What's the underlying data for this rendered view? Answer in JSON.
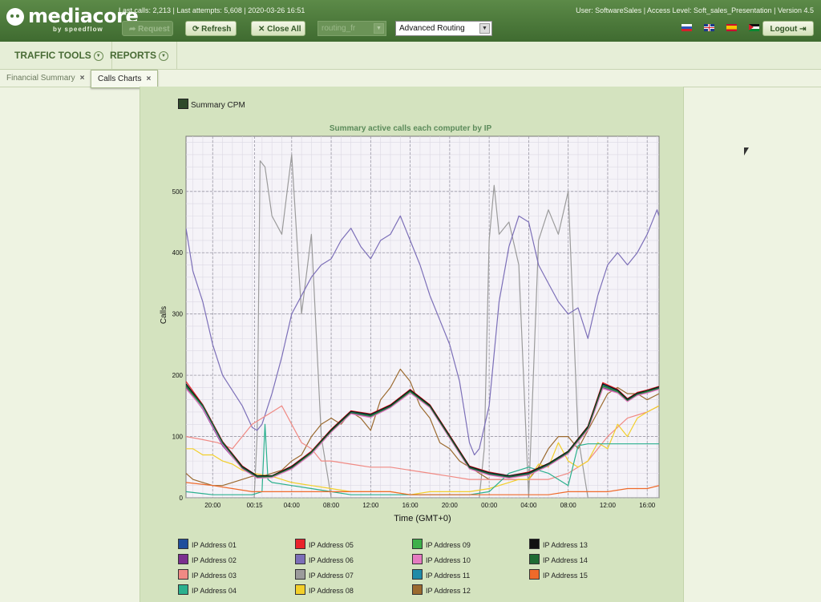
{
  "app": {
    "logo_name": "mediacore",
    "logo_tag": "by speedflow",
    "status_line": "Last calls: 2,213 | Last attempts: 5,608 | 2020-03-26 16:51",
    "user_line": "User: SoftwareSales | Access Level:    Soft_sales_Presentation | Version 4.5"
  },
  "toolbar": {
    "request_label": "Request",
    "refresh_label": "Refresh",
    "close_all_label": "Close All",
    "routing_select": "routing_fr",
    "routing_mode_select": "Advanced Routing",
    "logout_label": "Logout"
  },
  "menu": [
    {
      "label": "TRAFFIC TOOLS"
    },
    {
      "label": "REPORTS"
    }
  ],
  "tabs": [
    {
      "label": "Financial Summary",
      "active": false
    },
    {
      "label": "Calls Charts",
      "active": true
    }
  ],
  "colors": {
    "header": "#4a7a3a",
    "panel": "#d4e3bf",
    "plot_bg": "#f5f3f8"
  },
  "chart_data": {
    "type": "line",
    "top_legend": "Summary CPM",
    "title": "Summary active calls each computer by IP",
    "xlabel": "Time (GMT+0)",
    "ylabel": "Calls",
    "ylim": [
      0,
      590
    ],
    "yticks": [
      0,
      100,
      200,
      300,
      400,
      500
    ],
    "xlim": [
      17.3,
      65.2
    ],
    "xticks": [
      {
        "v": 20,
        "label": "20:00"
      },
      {
        "v": 24.25,
        "label": "00:15"
      },
      {
        "v": 28,
        "label": "04:00"
      },
      {
        "v": 32,
        "label": "08:00"
      },
      {
        "v": 36,
        "label": "12:00"
      },
      {
        "v": 40,
        "label": "16:00"
      },
      {
        "v": 44,
        "label": "20:00"
      },
      {
        "v": 48,
        "label": "00:00"
      },
      {
        "v": 52,
        "label": "04:00"
      },
      {
        "v": 56,
        "label": "08:00"
      },
      {
        "v": 60,
        "label": "12:00"
      },
      {
        "v": 64,
        "label": "16:00"
      }
    ],
    "series": [
      {
        "name": "IP Address 01",
        "color": "#1f4e9c",
        "x": [
          17.3,
          19,
          21,
          23,
          24.5,
          26,
          28,
          30,
          32,
          34,
          36,
          38,
          40,
          42,
          44,
          46,
          48,
          50,
          52,
          54,
          56,
          58,
          59.5,
          61,
          62,
          63,
          64,
          65.2
        ],
        "values": [
          185,
          150,
          90,
          50,
          35,
          35,
          50,
          75,
          110,
          140,
          135,
          150,
          175,
          150,
          100,
          50,
          40,
          35,
          40,
          55,
          75,
          115,
          185,
          175,
          160,
          170,
          175,
          180
        ]
      },
      {
        "name": "IP Address 02",
        "color": "#7b2f8f",
        "x": [
          17.3,
          19,
          21,
          23,
          24.5,
          26,
          28,
          30,
          32,
          34,
          36,
          38,
          40,
          42,
          44,
          46,
          48,
          50,
          52,
          54,
          56,
          58,
          59.5,
          61,
          62,
          63,
          64,
          65.2
        ],
        "values": [
          180,
          145,
          85,
          48,
          33,
          34,
          48,
          72,
          108,
          138,
          132,
          148,
          172,
          148,
          98,
          48,
          38,
          33,
          38,
          53,
          73,
          112,
          180,
          172,
          158,
          168,
          172,
          178
        ]
      },
      {
        "name": "IP Address 03",
        "color": "#f08a84",
        "x": [
          17.3,
          19,
          20.5,
          22,
          24,
          26,
          27,
          28,
          29,
          30,
          31,
          32,
          34,
          36,
          38,
          40,
          42,
          44,
          46,
          48,
          50,
          52,
          54,
          56,
          58,
          60,
          62,
          64,
          65.2
        ],
        "values": [
          100,
          95,
          90,
          80,
          120,
          140,
          150,
          120,
          90,
          80,
          60,
          60,
          55,
          50,
          50,
          45,
          40,
          35,
          30,
          30,
          30,
          30,
          30,
          40,
          60,
          100,
          130,
          140,
          150
        ]
      },
      {
        "name": "IP Address 04",
        "color": "#2bb08e",
        "x": [
          17.3,
          20,
          22,
          24,
          25,
          25.3,
          25.6,
          26,
          28,
          30,
          32,
          34,
          36,
          38,
          40,
          42,
          44,
          46,
          48,
          50,
          52,
          54,
          56,
          57,
          58,
          60,
          62,
          64,
          65.2
        ],
        "values": [
          10,
          5,
          5,
          5,
          10,
          120,
          30,
          25,
          20,
          15,
          10,
          5,
          5,
          5,
          5,
          5,
          5,
          5,
          10,
          40,
          50,
          40,
          20,
          85,
          88,
          88,
          88,
          88,
          88
        ]
      },
      {
        "name": "IP Address 05",
        "color": "#e8232b",
        "x": [
          17.3,
          19,
          21,
          23,
          24.5,
          26,
          28,
          30,
          32,
          34,
          36,
          38,
          40,
          42,
          44,
          46,
          48,
          50,
          52,
          54,
          56,
          58,
          59.5,
          61,
          62,
          63,
          64,
          65.2
        ],
        "values": [
          190,
          152,
          92,
          52,
          36,
          36,
          52,
          76,
          112,
          142,
          137,
          152,
          177,
          152,
          102,
          52,
          42,
          36,
          42,
          56,
          76,
          117,
          188,
          177,
          162,
          172,
          176,
          182
        ]
      },
      {
        "name": "IP Address 06",
        "color": "#7c6fb8",
        "x": [
          17.3,
          18,
          19,
          20,
          21,
          22,
          23,
          24,
          24.5,
          25,
          26,
          27,
          28,
          29,
          30,
          31,
          32,
          33,
          34,
          35,
          36,
          37,
          38,
          39,
          40,
          41,
          42,
          43,
          44,
          45,
          46,
          46.5,
          47,
          48,
          49,
          50,
          51,
          52,
          53,
          54,
          55,
          56,
          57,
          58,
          59,
          60,
          61,
          62,
          63,
          64,
          65,
          65.2
        ],
        "values": [
          440,
          370,
          320,
          250,
          200,
          175,
          150,
          115,
          110,
          120,
          170,
          230,
          300,
          330,
          360,
          380,
          390,
          420,
          440,
          410,
          390,
          420,
          430,
          460,
          420,
          380,
          330,
          290,
          250,
          190,
          90,
          70,
          80,
          150,
          320,
          410,
          460,
          450,
          380,
          350,
          320,
          300,
          310,
          260,
          330,
          380,
          400,
          380,
          400,
          430,
          470,
          460
        ]
      },
      {
        "name": "IP Address 07",
        "color": "#9b9b9b",
        "x": [
          17.3,
          24.2,
          24.5,
          24.8,
          25.3,
          26,
          27,
          28,
          29,
          30,
          31,
          32,
          33,
          34,
          46,
          47,
          47.5,
          48,
          48.5,
          49,
          50,
          51,
          52,
          53,
          54,
          55,
          56,
          57,
          58,
          59,
          65.2
        ],
        "values": [
          0,
          0,
          100,
          550,
          540,
          460,
          430,
          560,
          300,
          430,
          100,
          0,
          0,
          0,
          0,
          0,
          80,
          420,
          510,
          430,
          450,
          380,
          0,
          420,
          470,
          430,
          500,
          100,
          0,
          0,
          0
        ]
      },
      {
        "name": "IP Address 08",
        "color": "#f2cf2a",
        "x": [
          17.3,
          18,
          19,
          20,
          21,
          22,
          23,
          24,
          26,
          28,
          30,
          32,
          34,
          36,
          38,
          40,
          42,
          44,
          46,
          48,
          50,
          51,
          52,
          53,
          54,
          55,
          56,
          57,
          58,
          59,
          60,
          61,
          62,
          63,
          64,
          65.2
        ],
        "values": [
          80,
          80,
          70,
          70,
          60,
          55,
          45,
          40,
          35,
          25,
          20,
          15,
          10,
          10,
          10,
          5,
          10,
          10,
          10,
          15,
          25,
          30,
          30,
          55,
          50,
          90,
          60,
          50,
          60,
          90,
          80,
          120,
          100,
          130,
          140,
          150
        ]
      },
      {
        "name": "IP Address 09",
        "color": "#3db04a",
        "x": [
          17.3,
          19,
          21,
          23,
          24.5,
          26,
          28,
          30,
          32,
          34,
          36,
          38,
          40,
          42,
          44,
          46,
          48,
          50,
          52,
          54,
          56,
          58,
          59.5,
          61,
          62,
          63,
          64,
          65.2
        ],
        "values": [
          182,
          148,
          88,
          49,
          34,
          34,
          49,
          73,
          109,
          139,
          133,
          149,
          173,
          149,
          99,
          49,
          39,
          34,
          39,
          54,
          74,
          113,
          182,
          173,
          159,
          169,
          173,
          179
        ]
      },
      {
        "name": "IP Address 10",
        "color": "#e57bc1",
        "x": [
          17.3,
          19,
          21,
          23,
          24.5,
          26,
          28,
          30,
          32,
          34,
          36,
          38,
          40,
          42,
          44,
          46,
          48,
          50,
          52,
          54,
          56,
          58,
          59.5,
          61,
          62,
          63,
          64,
          65.2
        ],
        "values": [
          178,
          146,
          87,
          47,
          32,
          33,
          47,
          71,
          107,
          137,
          131,
          147,
          171,
          147,
          97,
          47,
          37,
          32,
          37,
          52,
          72,
          111,
          178,
          171,
          157,
          167,
          171,
          177
        ]
      },
      {
        "name": "IP Address 11",
        "color": "#1f8ba8",
        "x": [
          17.3,
          19,
          21,
          23,
          24.5,
          26,
          28,
          30,
          32,
          34,
          36,
          38,
          40,
          42,
          44,
          46,
          48,
          50,
          52,
          54,
          56,
          58,
          59.5,
          61,
          62,
          63,
          64,
          65.2
        ],
        "values": [
          184,
          149,
          89,
          50,
          35,
          35,
          50,
          74,
          110,
          140,
          134,
          150,
          174,
          150,
          100,
          50,
          40,
          35,
          40,
          55,
          75,
          114,
          184,
          174,
          160,
          170,
          174,
          180
        ]
      },
      {
        "name": "IP Address 12",
        "color": "#9b6a2f",
        "x": [
          17.3,
          18,
          19,
          20,
          21,
          22,
          23,
          24,
          25,
          26,
          27,
          28,
          29,
          30,
          31,
          32,
          33,
          34,
          35,
          36,
          37,
          38,
          39,
          40,
          41,
          42,
          43,
          44,
          45,
          46,
          47,
          48,
          49,
          50,
          51,
          52,
          53,
          54,
          55,
          56,
          57,
          58,
          59,
          60,
          61,
          62,
          63,
          64,
          65.2
        ],
        "values": [
          40,
          30,
          25,
          20,
          20,
          25,
          30,
          35,
          35,
          40,
          45,
          60,
          70,
          100,
          120,
          130,
          120,
          140,
          130,
          110,
          160,
          180,
          210,
          190,
          150,
          130,
          90,
          80,
          60,
          50,
          40,
          30,
          30,
          30,
          30,
          30,
          50,
          80,
          100,
          100,
          80,
          110,
          140,
          170,
          180,
          170,
          170,
          160,
          170
        ]
      },
      {
        "name": "IP Address 13",
        "color": "#111111",
        "x": [
          17.3,
          19,
          21,
          23,
          24.5,
          26,
          28,
          30,
          32,
          34,
          36,
          38,
          40,
          42,
          44,
          46,
          48,
          50,
          52,
          54,
          56,
          58,
          59.5,
          61,
          62,
          63,
          64,
          65.2
        ],
        "values": [
          186,
          151,
          91,
          51,
          36,
          36,
          51,
          75,
          111,
          141,
          136,
          151,
          176,
          151,
          101,
          51,
          41,
          36,
          41,
          56,
          76,
          116,
          186,
          176,
          161,
          171,
          175,
          181
        ]
      },
      {
        "name": "IP Address 14",
        "color": "#1f6b34",
        "x": [
          17.3,
          19,
          21,
          23,
          24.5,
          26,
          28,
          30,
          32,
          34,
          36,
          38,
          40,
          42,
          44,
          46,
          48,
          50,
          52,
          54,
          56,
          58,
          59.5,
          61,
          62,
          63,
          64,
          65.2
        ],
        "values": [
          183,
          150,
          90,
          49,
          34,
          35,
          49,
          74,
          109,
          139,
          134,
          149,
          174,
          149,
          99,
          49,
          39,
          34,
          39,
          54,
          74,
          114,
          183,
          174,
          159,
          169,
          174,
          179
        ]
      },
      {
        "name": "IP Address 15",
        "color": "#ef6a2a",
        "x": [
          17.3,
          20,
          22,
          24,
          26,
          28,
          30,
          32,
          34,
          36,
          38,
          40,
          42,
          44,
          46,
          48,
          50,
          52,
          54,
          56,
          58,
          60,
          62,
          64,
          65.2
        ],
        "values": [
          25,
          20,
          15,
          10,
          10,
          10,
          10,
          10,
          10,
          10,
          10,
          5,
          5,
          5,
          5,
          5,
          5,
          5,
          5,
          10,
          10,
          10,
          15,
          15,
          20
        ]
      }
    ]
  }
}
